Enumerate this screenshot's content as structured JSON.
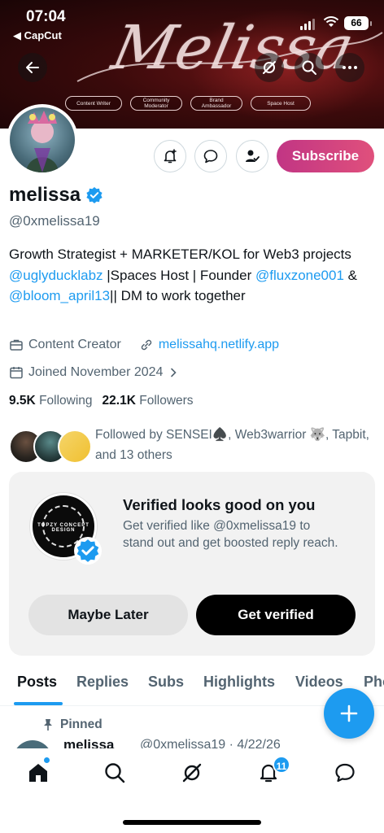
{
  "status": {
    "time": "07:04",
    "back_app": "◀ CapCut",
    "battery": "66"
  },
  "banner": {
    "script_title": "Melissa",
    "pills": [
      "Content Writer",
      "Community Moderator",
      "Brand Ambassador",
      "Space Host"
    ]
  },
  "profile": {
    "name": "melissa",
    "handle": "@0xmelissa19",
    "subscribe_label": "Subscribe",
    "bio": {
      "part1": "Growth Strategist + MARKETER/KOL for Web3 projects ",
      "link1": "@uglyducklabz",
      "part2": " |Spaces Host | Founder ",
      "link2": "@fluxzone001",
      "part3": " & ",
      "link3": "@bloom_april13",
      "part4": "|| DM to work together"
    },
    "category": "Content Creator",
    "website": "melissahq.netlify.app",
    "joined": "Joined November 2024",
    "following_count": "9.5K",
    "following_label": "Following",
    "followers_count": "22.1K",
    "followers_label": "Followers",
    "followed_by": "Followed by SENSEI♠️, Web3warrior 🐺, Tapbit, and 13 others"
  },
  "verify_card": {
    "title": "Verified looks good on you",
    "subtitle": "Get verified like @0xmelissa19 to stand out and get boosted reply reach.",
    "logo_text": "TOPZY CONCEPT DESIGN",
    "later_label": "Maybe Later",
    "verify_label": "Get verified"
  },
  "tabs": [
    "Posts",
    "Replies",
    "Subs",
    "Highlights",
    "Videos",
    "Pho"
  ],
  "pinned": {
    "label": "Pinned",
    "name": "melissa",
    "meta": "@0xmelissa19 · 4/22/26"
  },
  "nav": {
    "notifications_count": "11"
  },
  "colors": {
    "accent": "#1d9bf0",
    "subscribe_gradient": [
      "#c13584",
      "#e0507c"
    ],
    "text_primary": "#0f1419",
    "text_secondary": "#536471"
  },
  "icons": [
    "back-arrow-icon",
    "grok-icon",
    "search-icon",
    "more-icon",
    "bell-plus-icon",
    "message-icon",
    "person-check-icon",
    "verified-badge-icon",
    "briefcase-icon",
    "link-icon",
    "calendar-icon",
    "chevron-right-icon",
    "pin-icon",
    "plus-icon",
    "home-icon",
    "search-nav-icon",
    "grok-nav-icon",
    "bell-icon",
    "chat-icon"
  ]
}
